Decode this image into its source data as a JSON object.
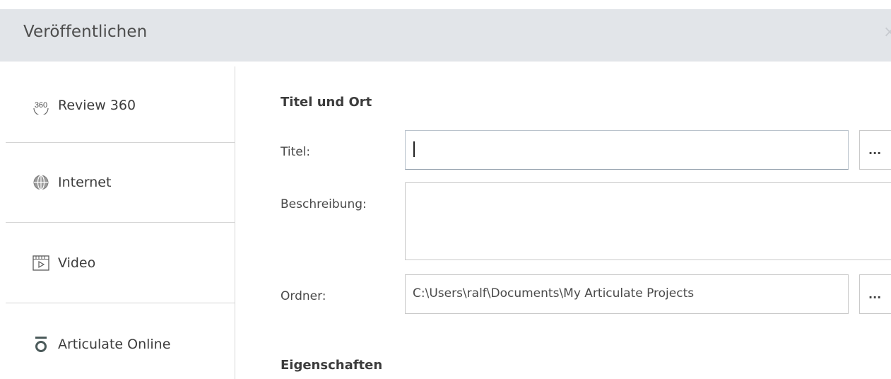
{
  "window": {
    "title": "Veröffentlichen",
    "close_glyph": "×"
  },
  "sidebar": {
    "items": [
      {
        "label": "Review 360",
        "icon": "review-360-icon"
      },
      {
        "label": "Internet",
        "icon": "globe-icon"
      },
      {
        "label": "Video",
        "icon": "video-icon"
      },
      {
        "label": "Articulate Online",
        "icon": "articulate-online-icon"
      }
    ]
  },
  "main": {
    "section_title_location": "Titel und Ort",
    "title_label": "Titel:",
    "title_value": "",
    "description_label": "Beschreibung:",
    "description_value": "",
    "folder_label": "Ordner:",
    "folder_value": "C:\\Users\\ralf\\Documents\\My Articulate Projects",
    "browse_label": "...",
    "section_title_properties": "Eigenschaften"
  },
  "colors": {
    "titlebar_bg": "#e2e5e9",
    "divider": "#d4d4d4",
    "text": "#3d3d3d"
  }
}
